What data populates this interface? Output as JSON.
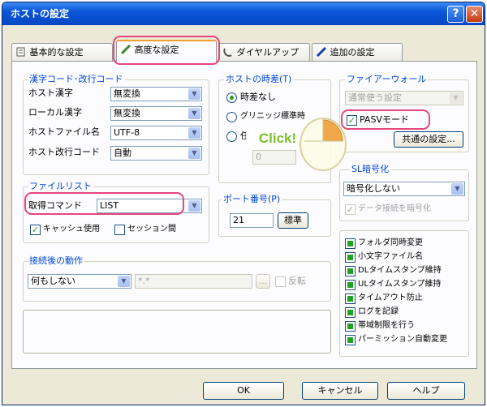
{
  "window": {
    "title": "ホストの設定"
  },
  "title_buttons": {
    "help": "?",
    "close": "✕"
  },
  "tabs": [
    {
      "label": "基本的な設定"
    },
    {
      "label": "高度な設定"
    },
    {
      "label": "ダイヤルアップ"
    },
    {
      "label": "追加の設定"
    }
  ],
  "kanji_code": {
    "title": "漢字コード･改行コード",
    "rows": [
      {
        "label": "ホスト漢字",
        "value": "無変換"
      },
      {
        "label": "ローカル漢字",
        "value": "無変換"
      },
      {
        "label": "ホストファイル名",
        "value": "UTF-8"
      },
      {
        "label": "ホスト改行コード",
        "value": "自動"
      }
    ]
  },
  "time_diff": {
    "title": "ホストの時差(T)",
    "opt_none": "時差なし",
    "opt_greenwich": "グリニッジ標準時",
    "opt_other": "任",
    "value": "0"
  },
  "firewall": {
    "title": "ファイアーウォール",
    "select": "通常使う設定",
    "pasv": "PASVモード",
    "common_button": "共通の設定..."
  },
  "encryption": {
    "title": "SL暗号化",
    "select": "暗号化しない",
    "data_encrypt": "データ接続を暗号化"
  },
  "file_list": {
    "title": "ファイルリスト",
    "cmd_label": "取得コマンド",
    "cmd_value": "LIST",
    "cache": "キャッシュ使用",
    "session": "セッション間"
  },
  "port": {
    "title": "ポート番号(P)",
    "value": "21",
    "default_button": "標準"
  },
  "after_connect": {
    "title": "接続後の動作",
    "select": "何もしない",
    "path": "*.*",
    "browse": "...",
    "reverse": "反転"
  },
  "options": [
    "フォルダ同時変更",
    "小文字ファイル名",
    "DLタイムスタンプ維持",
    "ULタイムスタンプ維持",
    "タイムアウト防止",
    "ログを記録",
    "帯域制限を行う",
    "パーミッション自動変更"
  ],
  "overlay": {
    "click_text": "Click!"
  },
  "buttons": {
    "ok": "OK",
    "cancel": "キャンセル",
    "help": "ヘルプ"
  },
  "colors": {
    "highlight": "#e8467c",
    "group_label": "#0046d5",
    "check_green": "#21a121"
  }
}
